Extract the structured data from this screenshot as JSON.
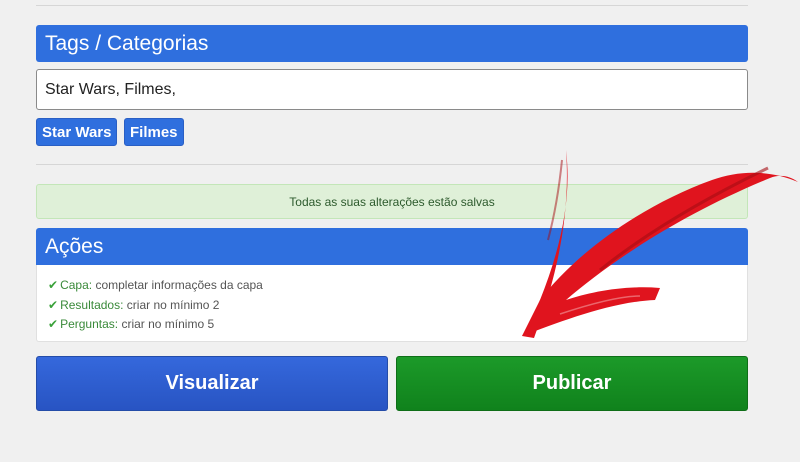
{
  "tags": {
    "header": "Tags / Categorias",
    "input_value": "Star Wars, Filmes,",
    "chips": [
      "Star Wars",
      "Filmes"
    ]
  },
  "alert": {
    "saved": "Todas as suas alterações estão salvas"
  },
  "acoes": {
    "header": "Ações",
    "items": [
      {
        "key": "Capa:",
        "value": "completar informações da capa"
      },
      {
        "key": "Resultados:",
        "value": "criar no mínimo 2"
      },
      {
        "key": "Perguntas:",
        "value": "criar no mínimo 5"
      }
    ]
  },
  "buttons": {
    "visualizar": "Visualizar",
    "publicar": "Publicar"
  },
  "icons": {
    "check": "check-icon",
    "annotation": "red-arrow-annotation"
  },
  "colors": {
    "primary": "#2f6fde",
    "success": "#16901f",
    "alert_bg": "#dff0d8",
    "arrow": "#e0141e"
  }
}
